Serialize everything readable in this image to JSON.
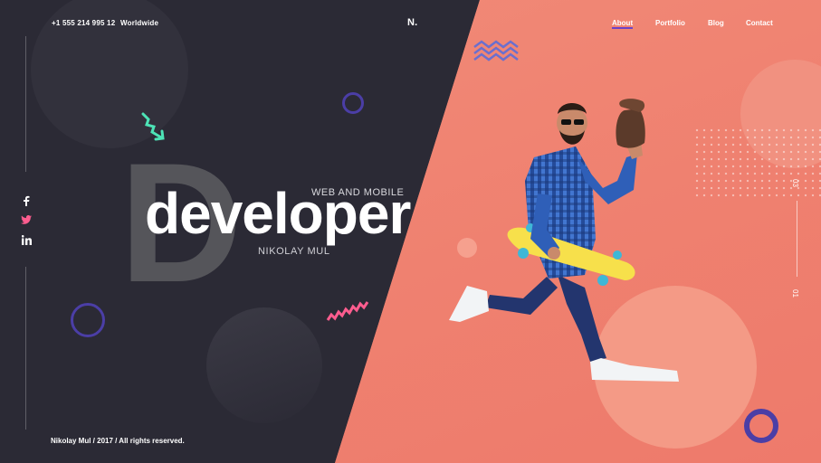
{
  "header": {
    "phone": "+1 555 214 995 12",
    "region": "Worldwide",
    "logo": "N."
  },
  "nav": {
    "items": [
      {
        "label": "About",
        "active": true
      },
      {
        "label": "Portfolio",
        "active": false
      },
      {
        "label": "Blog",
        "active": false
      },
      {
        "label": "Contact",
        "active": false
      }
    ]
  },
  "social": {
    "icons": [
      "facebook-icon",
      "twitter-icon",
      "linkedin-icon"
    ],
    "glyphs": [
      "f",
      "🐦",
      "in"
    ]
  },
  "hero": {
    "big_letter": "D",
    "kicker": "WEB AND MOBILE",
    "headline": "developer",
    "name": "NIKOLAY MUL"
  },
  "slider": {
    "total": "03",
    "current": "01"
  },
  "footer": {
    "text": "Nikolay Mul  / 2017 / All rights reserved."
  },
  "colors": {
    "dark_bg": "#2b2a35",
    "coral_bg": "#f08572",
    "accent_purple": "#5a3fb8",
    "accent_teal": "#5fe0c0",
    "accent_pink": "#ff5d8f",
    "skateboard_yellow": "#f7e04b"
  }
}
